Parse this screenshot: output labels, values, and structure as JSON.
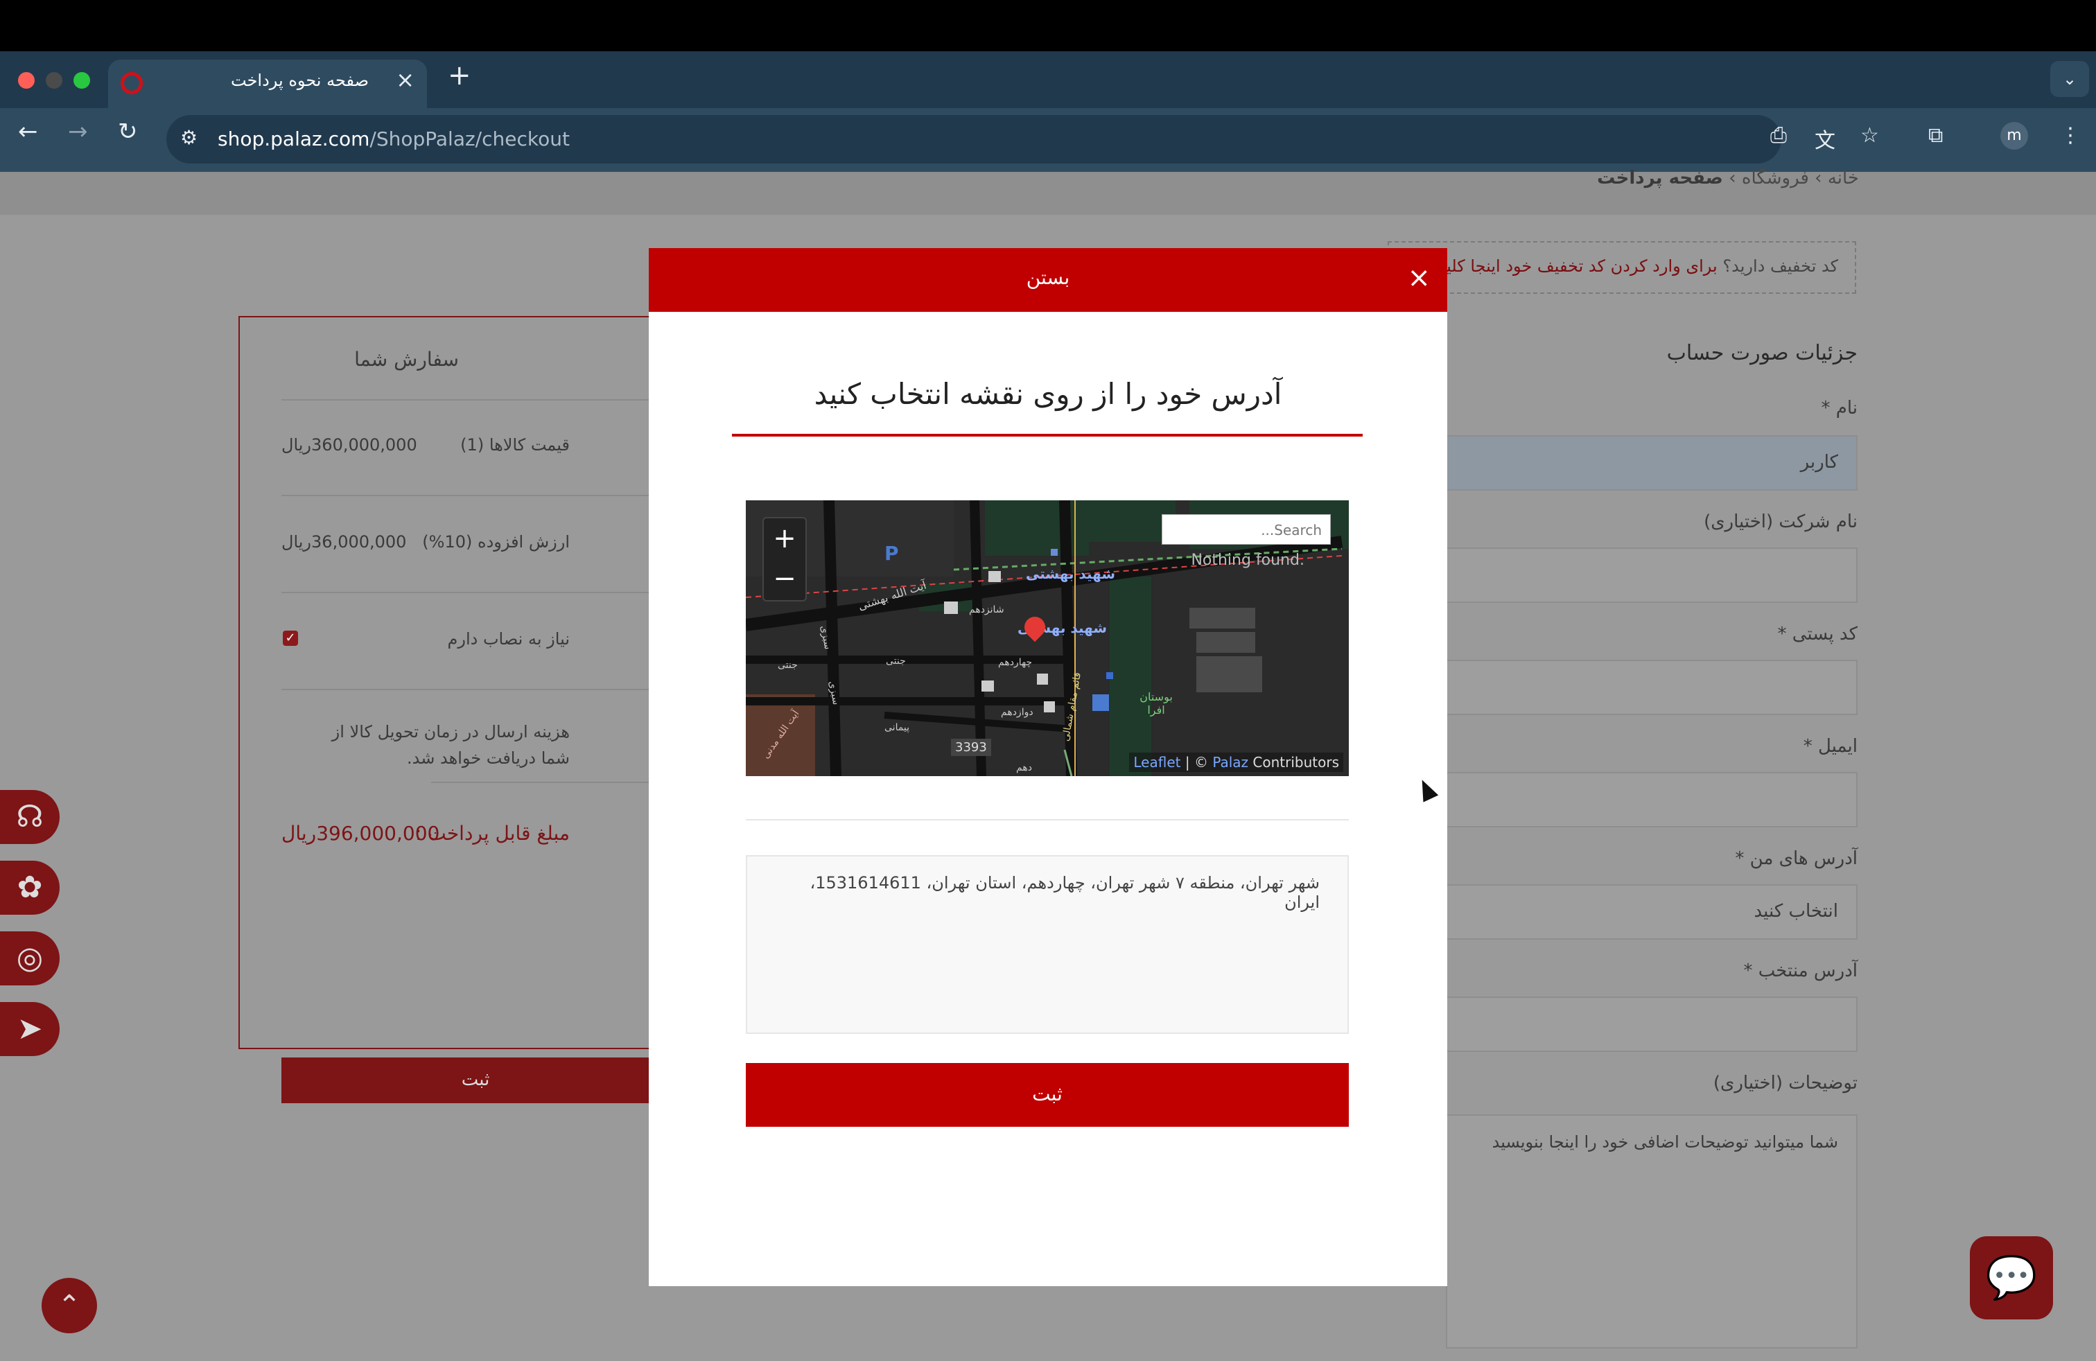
{
  "browser": {
    "tab_title": "صفحه نحوه پرداخت",
    "url_domain": "shop.palaz.com",
    "url_path": "/ShopPalaz/checkout",
    "profile_initial": "m"
  },
  "breadcrumb": {
    "home": "خانه",
    "sep1": "›",
    "shop": "فروشگاه",
    "sep2": "›",
    "current": "صفحه پرداخت"
  },
  "coupon": {
    "question": "کد تخفیف دارید؟",
    "link": "برای وارد کردن کد تخفیف خود اینجا کلیک کنید"
  },
  "order": {
    "title": "سفارش شما",
    "rows": [
      {
        "label": "قیمت کالاها (1)",
        "value": "360,000,000ریال"
      },
      {
        "label": "ارزش افزوده (10%)",
        "value": "36,000,000ریال"
      },
      {
        "label": "نیاز به نصاب دارم",
        "value": "✓"
      }
    ],
    "shipping_line1": "هزینه ارسال در زمان تحویل کالا از",
    "shipping_line2": "شما دریافت خواهد شد.",
    "total_label": "مبلغ قابل پرداخت :",
    "total_value": "396,000,000ریال",
    "submit": "ثبت"
  },
  "billing": {
    "title": "جزئیات صورت حساب",
    "name_label": "نام *",
    "name_value": "کاربر",
    "company_label": "نام شرکت (اختیاری)",
    "postal_label": "کد پستی *",
    "email_label": "ایمیل *",
    "my_addresses_label": "آدرس های من *",
    "my_addresses_value": "انتخاب کنید",
    "selected_address_label": "آدرس منتخب *",
    "notes_label": "توضیحات (اختیاری)",
    "notes_placeholder": "شما میتوانید توضیحات اضافی خود را اینجا بنویسید"
  },
  "modal": {
    "header": "بستن",
    "title": "آدرس خود را از روی نقشه انتخاب کنید",
    "map": {
      "search_placeholder": "Search...",
      "not_found": "Nothing found.",
      "zoom_in": "+",
      "zoom_out": "−",
      "attribution_leaflet": "Leaflet",
      "attribution_sep": "| ©",
      "attribution_palaz": "Palaz",
      "attribution_contrib": "Contributors",
      "labels": {
        "street1": "شهید بهشتی",
        "street2": "شهید بهشتی",
        "ayatollah": "آیت الله بهشتی",
        "shanzdahom": "شانزدهم",
        "chahardahom": "چهاردهم",
        "davazdahom": "دوازدهم",
        "sabzi": "سبزی",
        "janati": "جنتی",
        "janati2": "جنتی",
        "sabzi2": "سبزی",
        "peymani": "پیمانی",
        "park": "بوستان افرا",
        "qaem": "قائم مقام شمالی",
        "num": "3393",
        "dahom": "دهم",
        "madani": "آیت الله مدنی",
        "p": "P"
      }
    },
    "address_text": "شهر تهران، منطقه ۷ شهر تهران، چهاردهم، استان تهران، 1531614611، ایران",
    "submit": "ثبت"
  },
  "colors": {
    "brand_red": "#c00000",
    "dim_red": "#7d1416",
    "overlay_gray": "#9a9a9a"
  }
}
